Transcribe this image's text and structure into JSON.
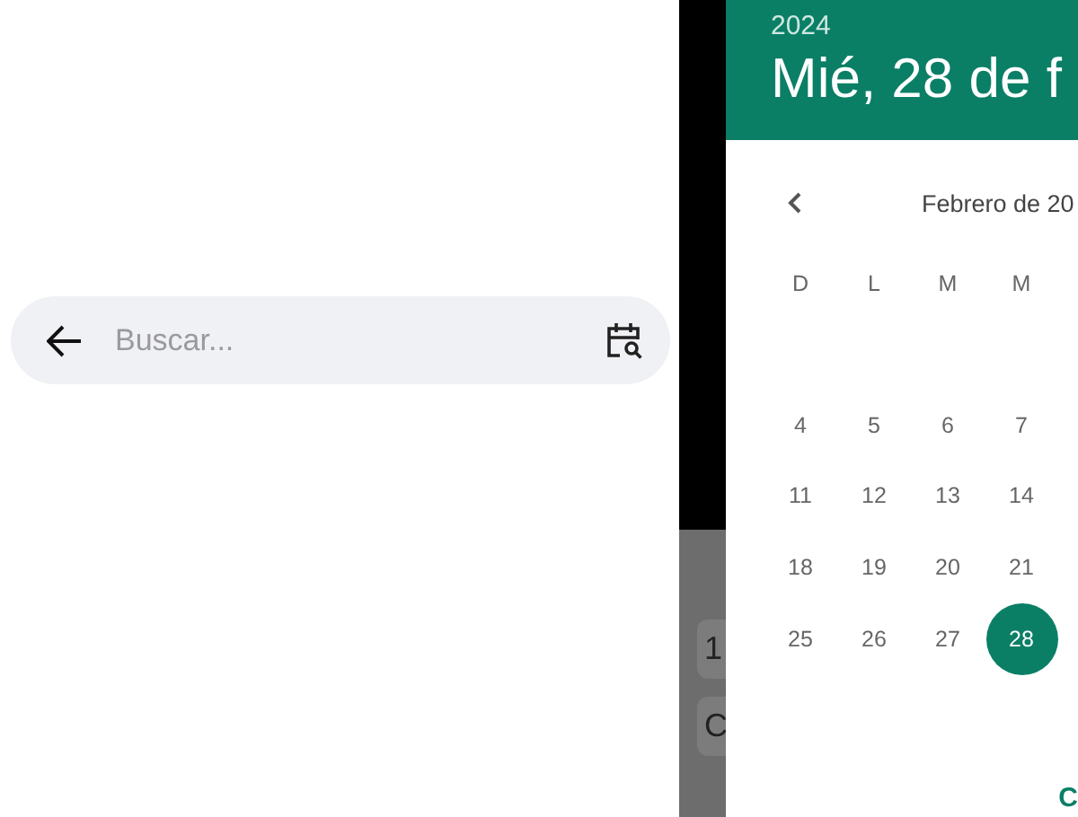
{
  "search": {
    "placeholder": "Buscar..."
  },
  "backdrop_keys": [
    "1",
    "C"
  ],
  "dialog": {
    "year": "2024",
    "date": "Mié, 28 de f",
    "month": "Febrero de 20",
    "weekdays": [
      "D",
      "L",
      "M",
      "M"
    ],
    "weeks": [
      [
        {
          "label": "4",
          "selected": false
        },
        {
          "label": "5",
          "selected": false
        },
        {
          "label": "6",
          "selected": false
        },
        {
          "label": "7",
          "selected": false
        }
      ],
      [
        {
          "label": "11",
          "selected": false
        },
        {
          "label": "12",
          "selected": false
        },
        {
          "label": "13",
          "selected": false
        },
        {
          "label": "14",
          "selected": false
        }
      ],
      [
        {
          "label": "18",
          "selected": false
        },
        {
          "label": "19",
          "selected": false
        },
        {
          "label": "20",
          "selected": false
        },
        {
          "label": "21",
          "selected": false
        }
      ],
      [
        {
          "label": "25",
          "selected": false
        },
        {
          "label": "26",
          "selected": false
        },
        {
          "label": "27",
          "selected": false
        },
        {
          "label": "28",
          "selected": true
        }
      ]
    ],
    "action": "C"
  }
}
